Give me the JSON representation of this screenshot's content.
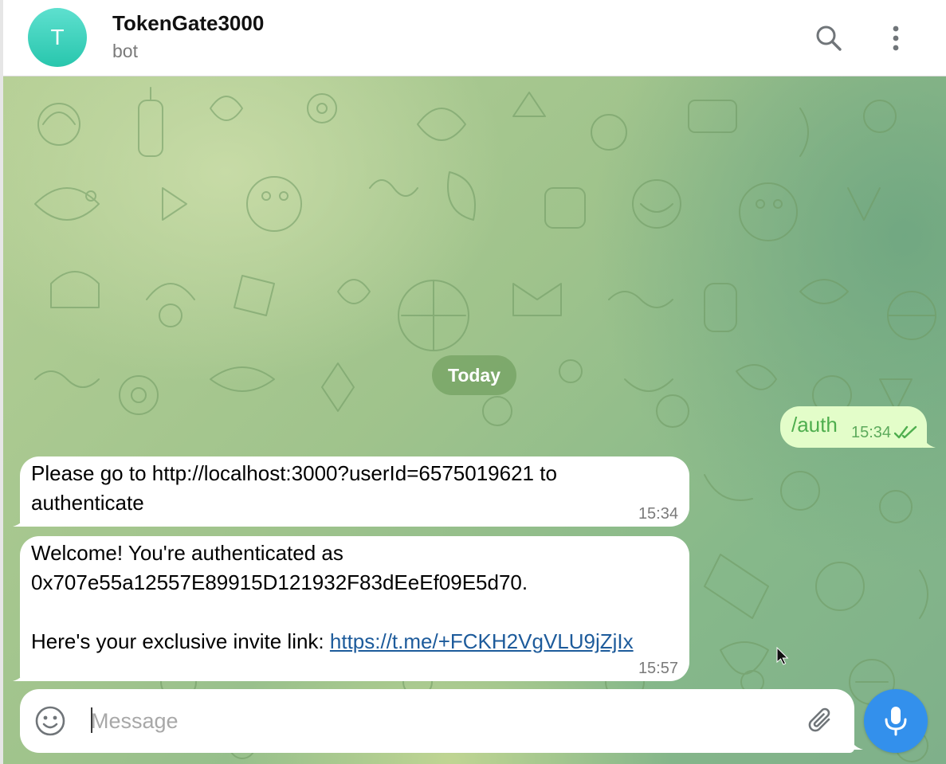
{
  "header": {
    "avatar_letter": "T",
    "title": "TokenGate3000",
    "subtitle": "bot",
    "avatar_color": "#2ec7b0",
    "icons": [
      "search-icon",
      "more-vertical-icon"
    ]
  },
  "chat": {
    "date_separator": "Today",
    "outgoing": [
      {
        "text": "/auth",
        "time": "15:34",
        "status": "read"
      }
    ],
    "incoming": [
      {
        "text": "Please go to http://localhost:3000?userId=6575019621 to authenticate",
        "time": "15:34"
      },
      {
        "text": "Welcome! You're authenticated as 0x707e55a12557E89915D121932F83dEeEf09E5d70.\n\nHere's your exclusive invite link: ",
        "link": "https://t.me/+FCKH2VgVLU9jZjIx",
        "time": "15:57"
      }
    ]
  },
  "composer": {
    "placeholder": "Message",
    "value": "",
    "icons": [
      "emoji-icon",
      "paperclip-icon",
      "microphone-icon"
    ],
    "accent": "#3390ec"
  },
  "colors": {
    "outgoing_bubble": "#e3fdc9",
    "outgoing_text": "#4fae4e",
    "incoming_bubble": "#ffffff",
    "link": "#1d5b9b"
  }
}
